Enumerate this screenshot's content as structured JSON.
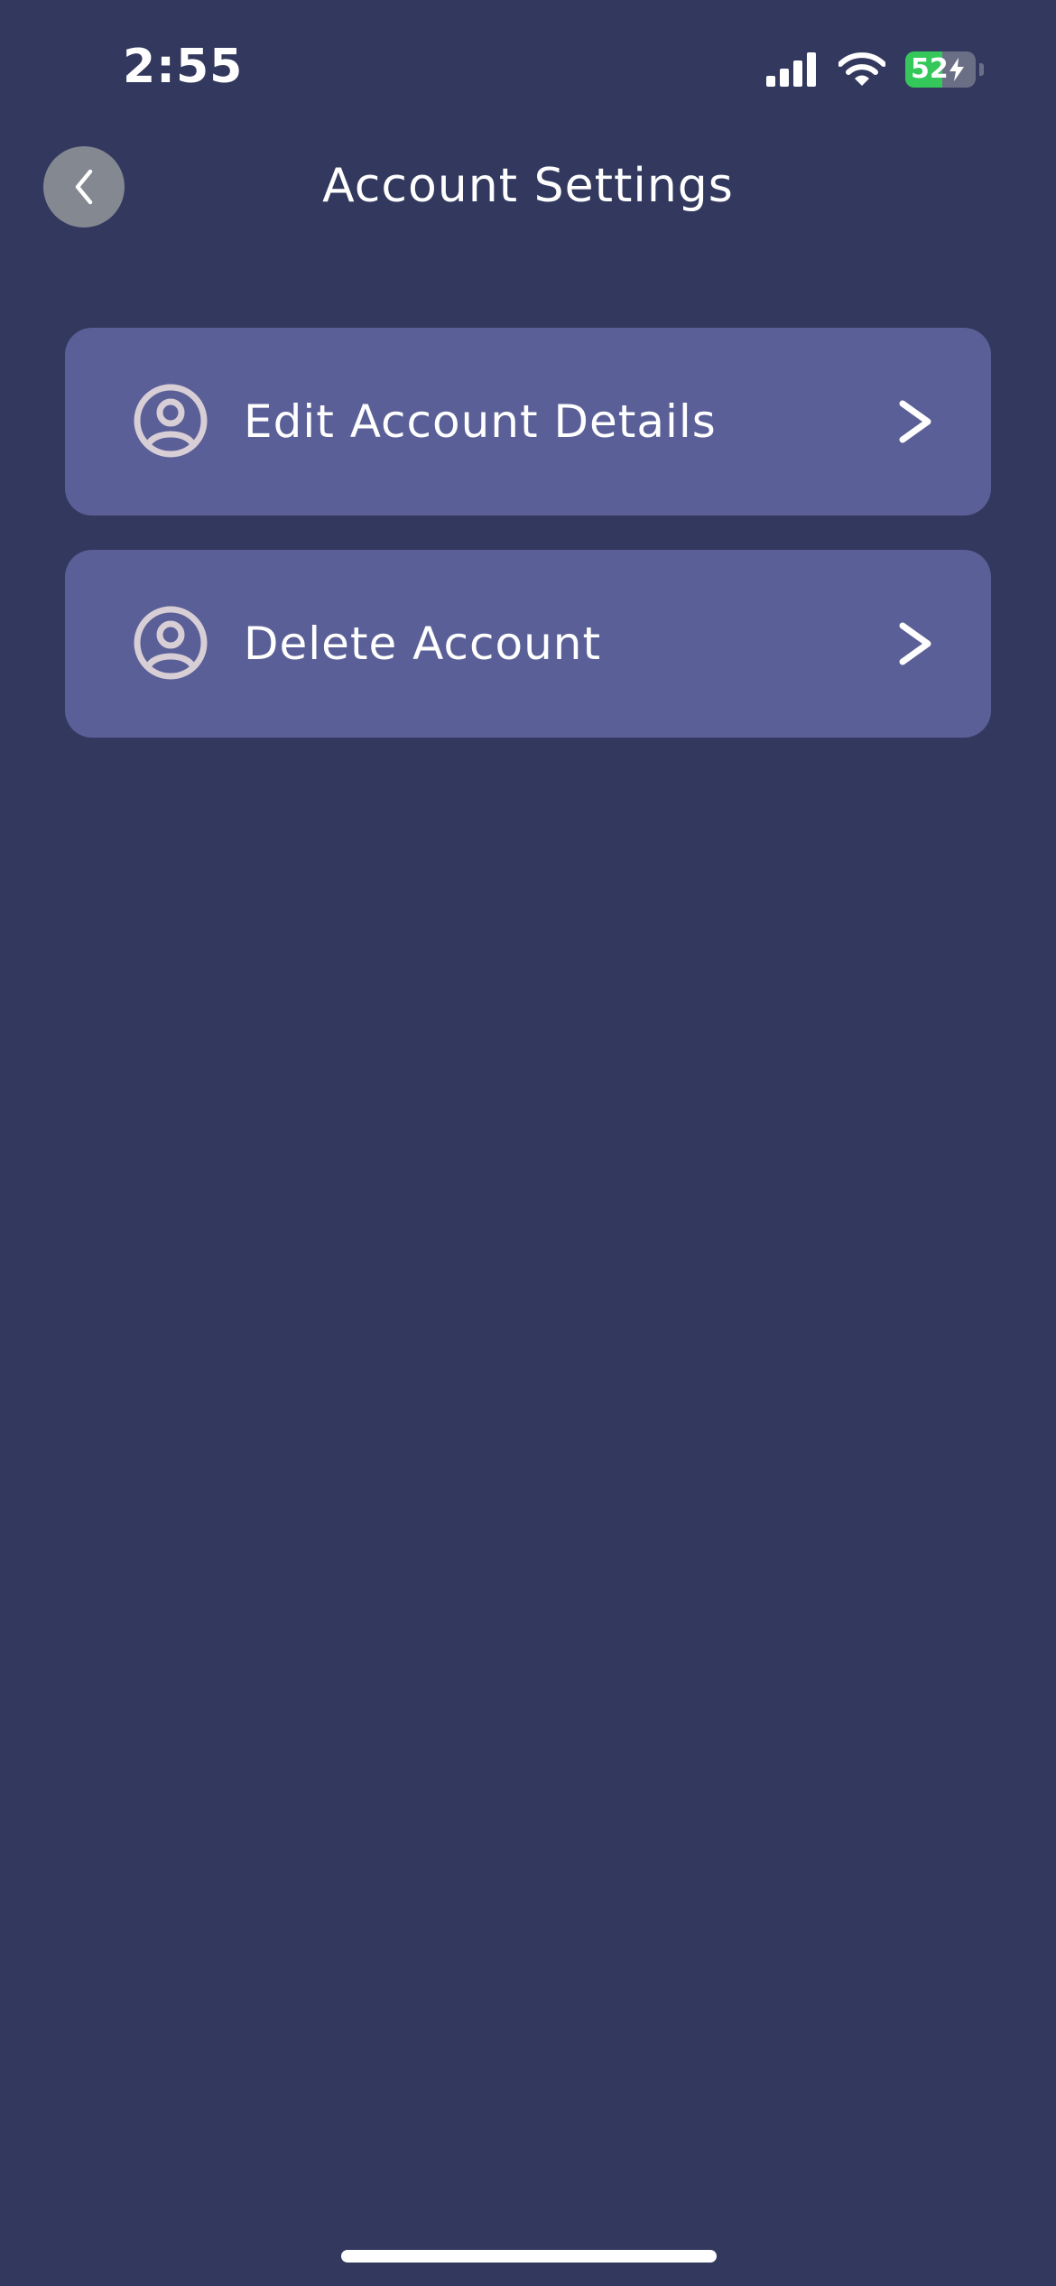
{
  "status_bar": {
    "time": "2:55",
    "battery_level": "52",
    "battery_fraction": 0.52,
    "battery_color": "#34c759"
  },
  "header": {
    "title": "Account Settings",
    "back_icon": "chevron-left-icon"
  },
  "menu": {
    "items": [
      {
        "label": "Edit Account Details",
        "icon": "user-circle-icon",
        "trailing_icon": "chevron-right-icon"
      },
      {
        "label": "Delete Account",
        "icon": "user-circle-icon",
        "trailing_icon": "chevron-right-icon"
      }
    ]
  },
  "colors": {
    "background": "#33385e",
    "card": "#5a5f97",
    "back_button": "#848891",
    "icon_stroke": "#d8cfd6"
  }
}
